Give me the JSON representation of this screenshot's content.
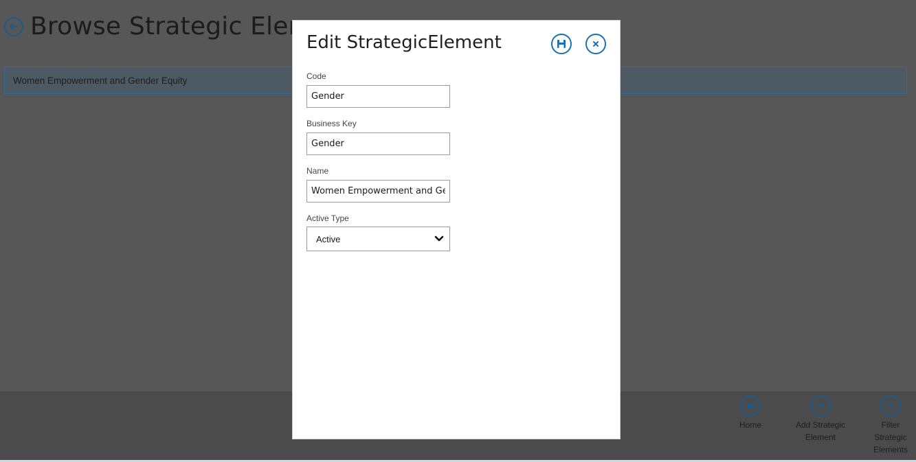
{
  "background": {
    "title": "Browse Strategic Elemen",
    "list_items": [
      "Women Empowerment and Gender Equity"
    ],
    "appbar": {
      "home_label": "Home",
      "add_label": "Add Strategic Element",
      "filter_label": "Filter Strategic Elements"
    }
  },
  "dialog": {
    "title": "Edit StrategicElement",
    "fields": {
      "code": {
        "label": "Code",
        "value": "Gender"
      },
      "business_key": {
        "label": "Business Key",
        "value": "Gender"
      },
      "name": {
        "label": "Name",
        "value": "Women Empowerment and Gender Equity"
      },
      "active_type": {
        "label": "Active Type",
        "value": "Active"
      }
    }
  },
  "colors": {
    "accent": "#1670b8",
    "overlay": "#575757"
  },
  "icons": {
    "back": "arrow-left-circle",
    "save": "floppy-disk",
    "close": "x-circle",
    "home": "home",
    "add": "plus-circle",
    "filter": "funnel"
  }
}
